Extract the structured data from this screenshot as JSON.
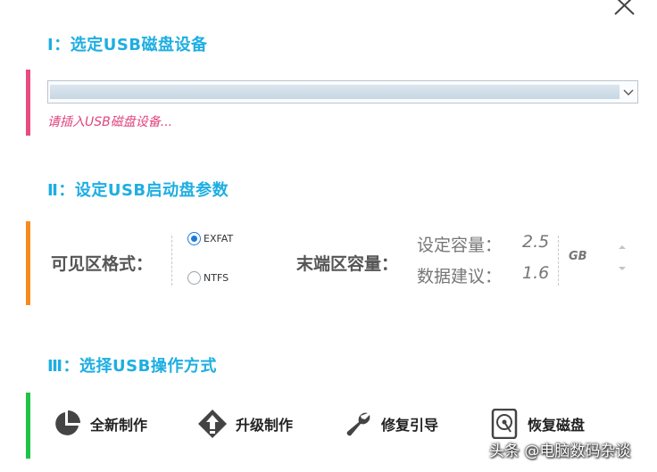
{
  "section1": {
    "title": "Ⅰ：选定USB磁盘设备",
    "device_select_value": "",
    "hint": "请插入USB磁盘设备..."
  },
  "section2": {
    "title": "Ⅱ：设定USB启动盘参数",
    "format_label": "可见区格式：",
    "format_options": [
      {
        "label": "EXFAT",
        "selected": true
      },
      {
        "label": "NTFS",
        "selected": false
      }
    ],
    "capacity_label": "末端区容量：",
    "set_capacity_label": "设定容量：",
    "set_capacity_value": "2.5",
    "suggest_label": "数据建议：",
    "suggest_value": "1.6",
    "unit": "GB"
  },
  "section3": {
    "title": "Ⅲ：选择USB操作方式",
    "operations": [
      {
        "label": "全新制作",
        "icon": "pie-chart-icon"
      },
      {
        "label": "升级制作",
        "icon": "upgrade-arrow-icon"
      },
      {
        "label": "修复引导",
        "icon": "wrench-icon"
      },
      {
        "label": "恢复磁盘",
        "icon": "hard-disk-icon"
      }
    ]
  },
  "watermark": "头条 @电脑数码杂谈",
  "colors": {
    "accent": "#1eaee2",
    "bar1": "#e84b82",
    "bar2": "#f68b1f",
    "bar3": "#1fc447",
    "hint": "#e0457e"
  }
}
